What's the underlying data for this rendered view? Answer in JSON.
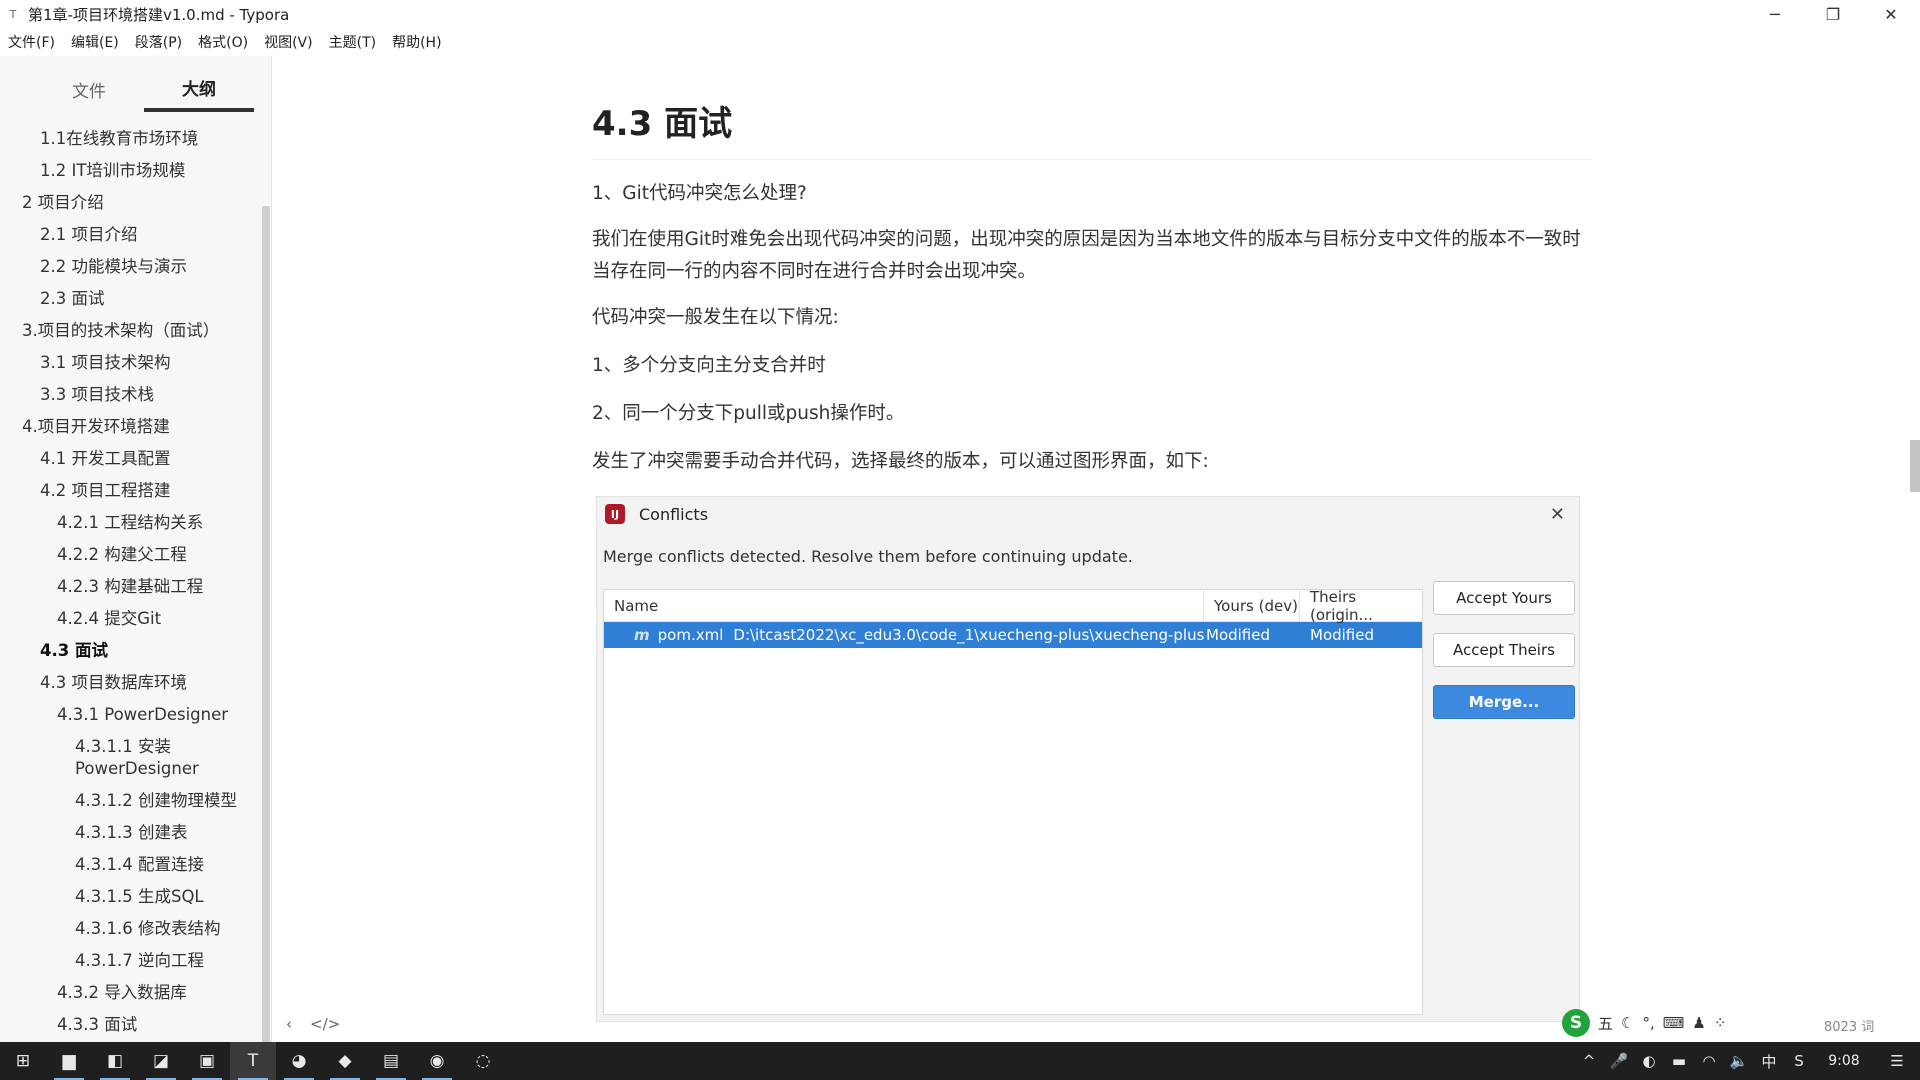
{
  "window": {
    "title": "第1章-项目环境搭建v1.0.md - Typora",
    "controls": {
      "minimize": "─",
      "maximize": "❐",
      "close": "✕"
    }
  },
  "menu": [
    "文件(F)",
    "编辑(E)",
    "段落(P)",
    "格式(O)",
    "视图(V)",
    "主题(T)",
    "帮助(H)"
  ],
  "sidebar": {
    "tabs": [
      "文件",
      "大纲"
    ],
    "active_tab": "大纲",
    "outline": [
      {
        "label": "1.1在线教育市场环境",
        "level": 2
      },
      {
        "label": "1.2 IT培训市场规模",
        "level": 2
      },
      {
        "label": "2 项目介绍",
        "level": 1
      },
      {
        "label": "2.1 项目介绍",
        "level": 2
      },
      {
        "label": "2.2 功能模块与演示",
        "level": 2
      },
      {
        "label": "2.3 面试",
        "level": 2
      },
      {
        "label": "3.项目的技术架构（面试）",
        "level": 1
      },
      {
        "label": "3.1 项目技术架构",
        "level": 2
      },
      {
        "label": "3.3 项目技术栈",
        "level": 2
      },
      {
        "label": "4.项目开发环境搭建",
        "level": 1
      },
      {
        "label": "4.1 开发工具配置",
        "level": 2
      },
      {
        "label": "4.2 项目工程搭建",
        "level": 2
      },
      {
        "label": "4.2.1 工程结构关系",
        "level": 3
      },
      {
        "label": "4.2.2 构建父工程",
        "level": 3
      },
      {
        "label": "4.2.3 构建基础工程",
        "level": 3
      },
      {
        "label": "4.2.4 提交Git",
        "level": 3
      },
      {
        "label": "4.3 面试",
        "level": 2,
        "active": true
      },
      {
        "label": "4.3 项目数据库环境",
        "level": 2
      },
      {
        "label": "4.3.1 PowerDesigner",
        "level": 3
      },
      {
        "label": "4.3.1.1 安装 PowerDesigner",
        "level": 4
      },
      {
        "label": "4.3.1.2 创建物理模型",
        "level": 4
      },
      {
        "label": "4.3.1.3 创建表",
        "level": 4
      },
      {
        "label": "4.3.1.4 配置连接",
        "level": 4
      },
      {
        "label": "4.3.1.5 生成SQL",
        "level": 4
      },
      {
        "label": "4.3.1.6 修改表结构",
        "level": 4
      },
      {
        "label": "4.3.1.7 逆向工程",
        "level": 4
      },
      {
        "label": "4.3.2 导入数据库",
        "level": 3
      },
      {
        "label": "4.3.3 面试",
        "level": 3
      }
    ]
  },
  "editor_bottom": {
    "back": "‹",
    "source": "</>"
  },
  "content": {
    "heading": "4.3 面试",
    "paragraphs": [
      "1、Git代码冲突怎么处理?",
      "我们在使用Git时难免会出现代码冲突的问题，出现冲突的原因是因为当本地文件的版本与目标分支中文件的版本不一致时当存在同一行的内容不同时在进行合并时会出现冲突。",
      "代码冲突一般发生在以下情况:",
      "1、多个分支向主分支合并时",
      "2、同一个分支下pull或push操作时。",
      "发生了冲突需要手动合并代码，选择最终的版本，可以通过图形界面，如下:"
    ]
  },
  "dialog": {
    "title": "Conflicts",
    "icon_text": "IJ",
    "close": "✕",
    "message": "Merge conflicts detected. Resolve them before continuing update.",
    "columns": [
      "Name",
      "Yours (dev)",
      "Theirs (origin..."
    ],
    "row": {
      "icon": "m",
      "name": "pom.xml",
      "path": "D:\\itcast2022\\xc_edu3.0\\code_1\\xuecheng-plus\\xuecheng-plus",
      "yours": "Modified",
      "theirs": "Modified"
    },
    "buttons": {
      "accept_yours": "Accept Yours",
      "accept_theirs": "Accept Theirs",
      "merge": "Merge..."
    }
  },
  "ime": {
    "logo": "S",
    "items": [
      "五",
      "☾",
      "°,",
      "⌨",
      "♟",
      "⁘"
    ]
  },
  "word_count": "8023 词",
  "taskbar": {
    "icons": [
      {
        "name": "windows-start-icon",
        "glyph": "⊞",
        "running": false
      },
      {
        "name": "file-explorer-icon",
        "glyph": "▆",
        "running": true
      },
      {
        "name": "intellij-icon",
        "glyph": "◧",
        "running": true
      },
      {
        "name": "app-orange-icon",
        "glyph": "◪",
        "running": true
      },
      {
        "name": "remote-desktop-icon",
        "glyph": "▣",
        "running": true
      },
      {
        "name": "typora-icon",
        "glyph": "T",
        "running": true,
        "active": true
      },
      {
        "name": "edge-icon",
        "glyph": "◕",
        "running": true
      },
      {
        "name": "acrobat-icon",
        "glyph": "◆",
        "running": true
      },
      {
        "name": "screenshot-tool-icon",
        "glyph": "▤",
        "running": true
      },
      {
        "name": "chrome-icon",
        "glyph": "◉",
        "running": true
      },
      {
        "name": "misc-app-icon",
        "glyph": "◌",
        "running": false
      }
    ],
    "tray": [
      "^",
      "🎤",
      "◐",
      "▬",
      "◠",
      "🔈",
      "中",
      "S"
    ],
    "clock": "9:08",
    "notification": "☰"
  },
  "colors": {
    "dialog_accent": "#3b8ae0",
    "selection": "#2f7fd6",
    "taskbar": "#1f1f1f"
  }
}
